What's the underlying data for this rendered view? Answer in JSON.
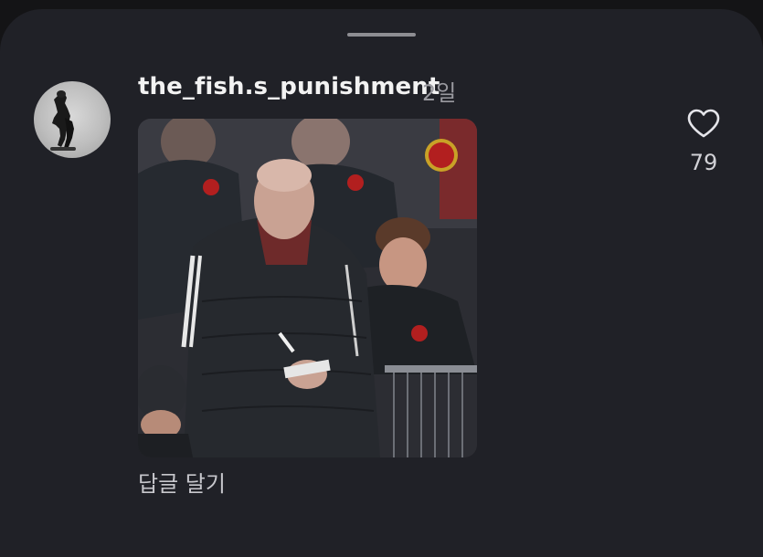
{
  "post": {
    "username": "the_fish.s_punishment",
    "time_ago": "2일",
    "reply_label": "답글 달기",
    "like_count": "79"
  },
  "icons": {
    "like": "heart-outline-icon",
    "grabber": "sheet-grabber-handle"
  },
  "colors": {
    "sheet_background": "#202127",
    "page_background": "#141416",
    "username": "#f2f2f2",
    "secondary_text": "#9a9aa0"
  }
}
